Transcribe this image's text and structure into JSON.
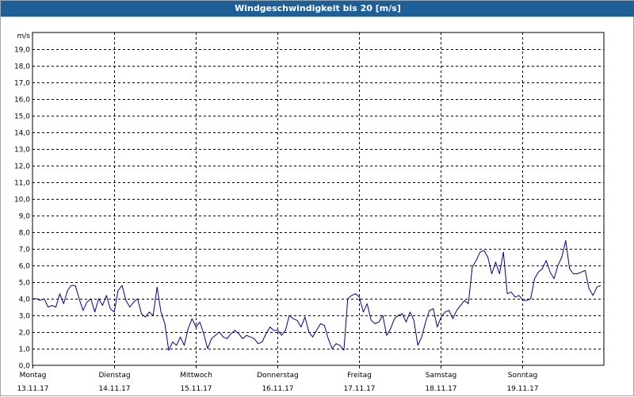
{
  "window": {
    "title": "Windgeschwindigkeit bis 20 [m/s]"
  },
  "chart_data": {
    "type": "line",
    "title": "Windgeschwindigkeit bis 20 [m/s]",
    "ylabel": "m/s",
    "xlabel": "",
    "ylim": [
      0,
      20
    ],
    "ytick_labels": [
      "0,0",
      "1,0",
      "2,0",
      "3,0",
      "4,0",
      "5,0",
      "6,0",
      "7,0",
      "8,0",
      "9,0",
      "10,0",
      "11,0",
      "12,0",
      "13,0",
      "14,0",
      "15,0",
      "16,0",
      "17,0",
      "18,0",
      "19,0"
    ],
    "grid": true,
    "days": [
      {
        "name": "Montag",
        "date": "13.11.17"
      },
      {
        "name": "Dienstag",
        "date": "14.11.17"
      },
      {
        "name": "Mittwoch",
        "date": "15.11.17"
      },
      {
        "name": "Donnerstag",
        "date": "16.11.17"
      },
      {
        "name": "Freitag",
        "date": "17.11.17"
      },
      {
        "name": "Samstag",
        "date": "18.11.17"
      },
      {
        "name": "Sonntag",
        "date": "19.11.17"
      }
    ],
    "series": [
      {
        "color": "#00008b",
        "values": [
          4.0,
          4.0,
          3.9,
          4.0,
          3.5,
          3.6,
          3.5,
          4.3,
          3.7,
          4.5,
          4.8,
          4.8,
          4.0,
          3.3,
          3.8,
          4.0,
          3.2,
          4.0,
          3.6,
          4.2,
          3.4,
          3.2,
          4.5,
          4.8,
          3.9,
          3.5,
          3.8,
          4.0,
          3.1,
          2.9,
          3.2,
          3.0,
          4.7,
          3.2,
          2.5,
          0.9,
          1.4,
          1.2,
          1.7,
          1.2,
          2.2,
          2.8,
          2.3,
          2.6,
          1.9,
          1.0,
          1.6,
          1.8,
          2.0,
          1.7,
          1.6,
          1.9,
          2.1,
          1.9,
          1.6,
          1.8,
          1.7,
          1.6,
          1.3,
          1.4,
          1.9,
          2.3,
          2.1,
          2.1,
          1.8,
          2.1,
          3.0,
          2.8,
          2.7,
          2.3,
          2.9,
          2.0,
          1.7,
          2.1,
          2.5,
          2.4,
          1.6,
          1.0,
          1.3,
          1.2,
          0.9,
          4.0,
          4.2,
          4.3,
          4.1,
          3.2,
          3.7,
          2.7,
          2.5,
          2.6,
          3.0,
          1.8,
          2.2,
          2.8,
          3.0,
          3.1,
          2.6,
          3.2,
          2.7,
          1.2,
          1.7,
          2.6,
          3.3,
          3.4,
          2.3,
          2.9,
          3.2,
          3.3,
          2.8,
          3.3,
          3.6,
          3.9,
          3.7,
          5.9,
          6.3,
          6.8,
          6.9,
          6.5,
          5.5,
          6.2,
          5.5,
          6.8,
          4.3,
          4.4,
          4.1,
          4.2,
          3.9,
          3.9,
          4.0,
          5.2,
          5.6,
          5.8,
          6.3,
          5.6,
          5.2,
          6.0,
          6.5,
          7.5,
          5.8,
          5.5,
          5.5,
          5.6,
          5.7,
          4.6,
          4.2,
          4.7,
          4.8
        ]
      }
    ]
  }
}
